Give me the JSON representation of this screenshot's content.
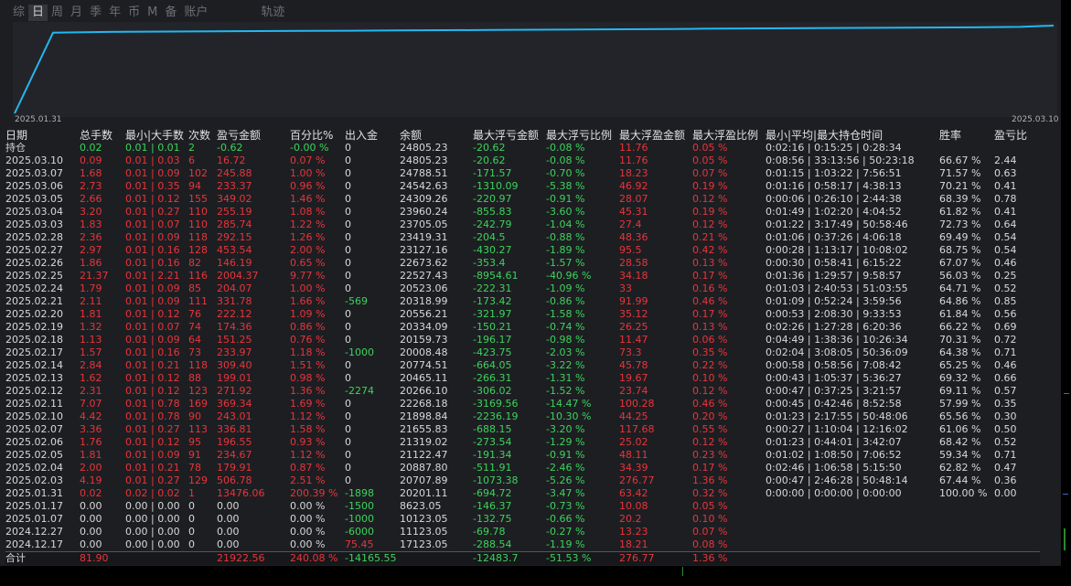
{
  "tabs": [
    "综",
    "日",
    "周",
    "月",
    "季",
    "年",
    "币",
    "M",
    "备",
    "账户",
    "轨迹"
  ],
  "active_tab": "日",
  "chart": {
    "start_label": "2025.01.31",
    "end_label": "2025.03.10",
    "line_color": "#22b8f0",
    "points": [
      0,
      0.92,
      0.93,
      0.935,
      0.94,
      0.945,
      0.95,
      0.955,
      0.96,
      0.965,
      0.97,
      0.975,
      0.98,
      0.985,
      1.0
    ]
  },
  "headers": [
    "日期",
    "总手数",
    "最小|大手数",
    "次数",
    "盈亏金额",
    "百分比%",
    "出入金",
    "余额",
    "最大浮亏金额",
    "最大浮亏比例",
    "最大浮盈金额",
    "最大浮盈比例",
    "最小|平均|最大持仓时间",
    "胜率",
    "盈亏比"
  ],
  "rows": [
    [
      "持仓",
      "0.02",
      "0.01 | 0.01",
      "2",
      "-0.62",
      "-0.00 %",
      "0",
      "24805.23",
      "-20.62",
      "-0.08 %",
      "11.76",
      "0.05 %",
      "0:02:16 | 0:15:25 | 0:28:34",
      "",
      ""
    ],
    [
      "2025.03.10",
      "0.09",
      "0.01 | 0.03",
      "6",
      "16.72",
      "0.07 %",
      "0",
      "24805.23",
      "-20.62",
      "-0.08 %",
      "11.76",
      "0.05 %",
      "0:08:56 | 33:13:56 | 50:23:18",
      "66.67 %",
      "2.44"
    ],
    [
      "2025.03.07",
      "1.68",
      "0.01 | 0.09",
      "102",
      "245.88",
      "1.00 %",
      "0",
      "24788.51",
      "-171.57",
      "-0.70 %",
      "18.23",
      "0.07 %",
      "0:01:15 | 1:03:22 | 7:56:51",
      "71.57 %",
      "0.63"
    ],
    [
      "2025.03.06",
      "2.73",
      "0.01 | 0.35",
      "94",
      "233.37",
      "0.96 %",
      "0",
      "24542.63",
      "-1310.09",
      "-5.38 %",
      "46.92",
      "0.19 %",
      "0:01:16 | 0:58:17 | 4:38:13",
      "70.21 %",
      "0.41"
    ],
    [
      "2025.03.05",
      "2.66",
      "0.01 | 0.12",
      "155",
      "349.02",
      "1.46 %",
      "0",
      "24309.26",
      "-220.97",
      "-0.91 %",
      "28.07",
      "0.12 %",
      "0:00:06 | 0:26:10 | 2:44:38",
      "68.39 %",
      "0.78"
    ],
    [
      "2025.03.04",
      "3.20",
      "0.01 | 0.27",
      "110",
      "255.19",
      "1.08 %",
      "0",
      "23960.24",
      "-855.83",
      "-3.60 %",
      "45.31",
      "0.19 %",
      "0:01:49 | 1:02:20 | 4:04:52",
      "61.82 %",
      "0.41"
    ],
    [
      "2025.03.03",
      "1.83",
      "0.01 | 0.07",
      "110",
      "285.74",
      "1.22 %",
      "0",
      "23705.05",
      "-242.79",
      "-1.04 %",
      "27.4",
      "0.12 %",
      "0:01:22 | 3:17:49 | 50:58:46",
      "72.73 %",
      "0.64"
    ],
    [
      "2025.02.28",
      "2.36",
      "0.01 | 0.09",
      "118",
      "292.15",
      "1.26 %",
      "0",
      "23419.31",
      "-204.5",
      "-0.88 %",
      "48.36",
      "0.21 %",
      "0:01:06 | 0:37:26 | 4:06:18",
      "69.49 %",
      "0.54"
    ],
    [
      "2025.02.27",
      "2.97",
      "0.01 | 0.16",
      "128",
      "453.54",
      "2.00 %",
      "0",
      "23127.16",
      "-430.27",
      "-1.89 %",
      "95.5",
      "0.42 %",
      "0:00:28 | 1:13:17 | 10:08:02",
      "68.75 %",
      "0.54"
    ],
    [
      "2025.02.26",
      "1.86",
      "0.01 | 0.16",
      "82",
      "146.19",
      "0.65 %",
      "0",
      "22673.62",
      "-353.4",
      "-1.57 %",
      "28.58",
      "0.13 %",
      "0:00:30 | 0:58:41 | 6:15:22",
      "67.07 %",
      "0.46"
    ],
    [
      "2025.02.25",
      "21.37",
      "0.01 | 2.21",
      "116",
      "2004.37",
      "9.77 %",
      "0",
      "22527.43",
      "-8954.61",
      "-40.96 %",
      "34.18",
      "0.17 %",
      "0:01:36 | 1:29:57 | 9:58:57",
      "56.03 %",
      "0.25"
    ],
    [
      "2025.02.24",
      "1.79",
      "0.01 | 0.09",
      "85",
      "204.07",
      "1.00 %",
      "0",
      "20523.06",
      "-222.31",
      "-1.09 %",
      "33",
      "0.16 %",
      "0:01:03 | 2:40:53 | 51:03:55",
      "64.71 %",
      "0.52"
    ],
    [
      "2025.02.21",
      "2.11",
      "0.01 | 0.09",
      "111",
      "331.78",
      "1.66 %",
      "-569",
      "20318.99",
      "-173.42",
      "-0.86 %",
      "91.99",
      "0.46 %",
      "0:01:09 | 0:52:24 | 3:59:56",
      "64.86 %",
      "0.85"
    ],
    [
      "2025.02.20",
      "1.81",
      "0.01 | 0.12",
      "76",
      "222.12",
      "1.09 %",
      "0",
      "20556.21",
      "-321.97",
      "-1.58 %",
      "35.12",
      "0.17 %",
      "0:00:53 | 2:08:30 | 9:33:53",
      "61.84 %",
      "0.56"
    ],
    [
      "2025.02.19",
      "1.32",
      "0.01 | 0.07",
      "74",
      "174.36",
      "0.86 %",
      "0",
      "20334.09",
      "-150.21",
      "-0.74 %",
      "26.25",
      "0.13 %",
      "0:02:26 | 1:27:28 | 6:20:36",
      "66.22 %",
      "0.69"
    ],
    [
      "2025.02.18",
      "1.13",
      "0.01 | 0.09",
      "64",
      "151.25",
      "0.76 %",
      "0",
      "20159.73",
      "-196.17",
      "-0.98 %",
      "11.47",
      "0.06 %",
      "0:04:49 | 1:38:36 | 10:26:34",
      "70.31 %",
      "0.72"
    ],
    [
      "2025.02.17",
      "1.57",
      "0.01 | 0.16",
      "73",
      "233.97",
      "1.18 %",
      "-1000",
      "20008.48",
      "-423.75",
      "-2.03 %",
      "73.3",
      "0.35 %",
      "0:02:04 | 3:08:05 | 50:36:09",
      "64.38 %",
      "0.71"
    ],
    [
      "2025.02.14",
      "2.84",
      "0.01 | 0.21",
      "118",
      "309.40",
      "1.51 %",
      "0",
      "20774.51",
      "-664.05",
      "-3.22 %",
      "45.78",
      "0.22 %",
      "0:00:58 | 0:58:56 | 7:08:42",
      "65.25 %",
      "0.46"
    ],
    [
      "2025.02.13",
      "1.62",
      "0.01 | 0.12",
      "88",
      "199.01",
      "0.98 %",
      "0",
      "20465.11",
      "-266.31",
      "-1.31 %",
      "19.67",
      "0.10 %",
      "0:00:43 | 1:05:37 | 5:36:27",
      "69.32 %",
      "0.66"
    ],
    [
      "2025.02.12",
      "2.31",
      "0.01 | 0.12",
      "123",
      "271.92",
      "1.36 %",
      "-2274",
      "20266.10",
      "-306.02",
      "-1.52 %",
      "23.74",
      "0.12 %",
      "0:00:47 | 0:37:25 | 3:21:57",
      "69.11 %",
      "0.57"
    ],
    [
      "2025.02.11",
      "7.07",
      "0.01 | 0.78",
      "169",
      "369.34",
      "1.69 %",
      "0",
      "22268.18",
      "-3169.56",
      "-14.47 %",
      "100.28",
      "0.46 %",
      "0:00:45 | 0:42:46 | 8:52:58",
      "57.99 %",
      "0.35"
    ],
    [
      "2025.02.10",
      "4.42",
      "0.01 | 0.78",
      "90",
      "243.01",
      "1.12 %",
      "0",
      "21898.84",
      "-2236.19",
      "-10.30 %",
      "44.25",
      "0.20 %",
      "0:01:23 | 2:17:55 | 50:48:06",
      "65.56 %",
      "0.30"
    ],
    [
      "2025.02.07",
      "3.36",
      "0.01 | 0.27",
      "113",
      "336.81",
      "1.58 %",
      "0",
      "21655.83",
      "-688.15",
      "-3.20 %",
      "117.68",
      "0.55 %",
      "0:00:27 | 1:10:04 | 12:16:02",
      "61.06 %",
      "0.50"
    ],
    [
      "2025.02.06",
      "1.76",
      "0.01 | 0.12",
      "95",
      "196.55",
      "0.93 %",
      "0",
      "21319.02",
      "-273.54",
      "-1.29 %",
      "25.02",
      "0.12 %",
      "0:01:23 | 0:44:01 | 3:42:07",
      "68.42 %",
      "0.52"
    ],
    [
      "2025.02.05",
      "1.81",
      "0.01 | 0.09",
      "91",
      "234.67",
      "1.12 %",
      "0",
      "21122.47",
      "-191.34",
      "-0.91 %",
      "48.11",
      "0.23 %",
      "0:01:02 | 1:08:50 | 7:06:52",
      "59.34 %",
      "0.71"
    ],
    [
      "2025.02.04",
      "2.00",
      "0.01 | 0.21",
      "78",
      "179.91",
      "0.87 %",
      "0",
      "20887.80",
      "-511.91",
      "-2.46 %",
      "34.39",
      "0.17 %",
      "0:02:46 | 1:06:58 | 5:15:50",
      "62.82 %",
      "0.47"
    ],
    [
      "2025.02.03",
      "4.19",
      "0.01 | 0.27",
      "129",
      "506.78",
      "2.51 %",
      "0",
      "20707.89",
      "-1073.38",
      "-5.26 %",
      "276.77",
      "1.36 %",
      "0:00:47 | 2:46:28 | 50:48:14",
      "67.44 %",
      "0.36"
    ],
    [
      "2025.01.31",
      "0.02",
      "0.02 | 0.02",
      "1",
      "13476.06",
      "200.39 %",
      "-1898",
      "20201.11",
      "-694.72",
      "-3.47 %",
      "63.42",
      "0.32 %",
      "0:00:00 | 0:00:00 | 0:00:00",
      "100.00 %",
      "0.00"
    ],
    [
      "2025.01.17",
      "0.00",
      "0.00 | 0.00",
      "0",
      "0.00",
      "0.00 %",
      "-1500",
      "8623.05",
      "-146.37",
      "-0.73 %",
      "10.08",
      "0.05 %",
      "",
      "",
      ""
    ],
    [
      "2025.01.07",
      "0.00",
      "0.00 | 0.00",
      "0",
      "0.00",
      "0.00 %",
      "-1000",
      "10123.05",
      "-132.75",
      "-0.66 %",
      "20.2",
      "0.10 %",
      "",
      "",
      ""
    ],
    [
      "2024.12.27",
      "0.00",
      "0.00 | 0.00",
      "0",
      "0.00",
      "0.00 %",
      "-6000",
      "11123.05",
      "-69.78",
      "-0.27 %",
      "13.23",
      "0.07 %",
      "",
      "",
      ""
    ],
    [
      "2024.12.17",
      "0.00",
      "0.00 | 0.00",
      "0",
      "0.00",
      "0.00 %",
      "75.45",
      "17123.05",
      "-288.54",
      "-1.19 %",
      "18.21",
      "0.08 %",
      "",
      "",
      ""
    ]
  ],
  "total": [
    "合计",
    "81.90",
    "",
    "",
    "21922.56",
    "240.08 %",
    "-14165.55",
    "",
    "-12483.7",
    "-51.53 %",
    "276.77",
    "1.36 %",
    "",
    "",
    ""
  ],
  "colors": {
    "red": "#e8353a",
    "green": "#3dd35c",
    "white": "#d8d8d8"
  }
}
